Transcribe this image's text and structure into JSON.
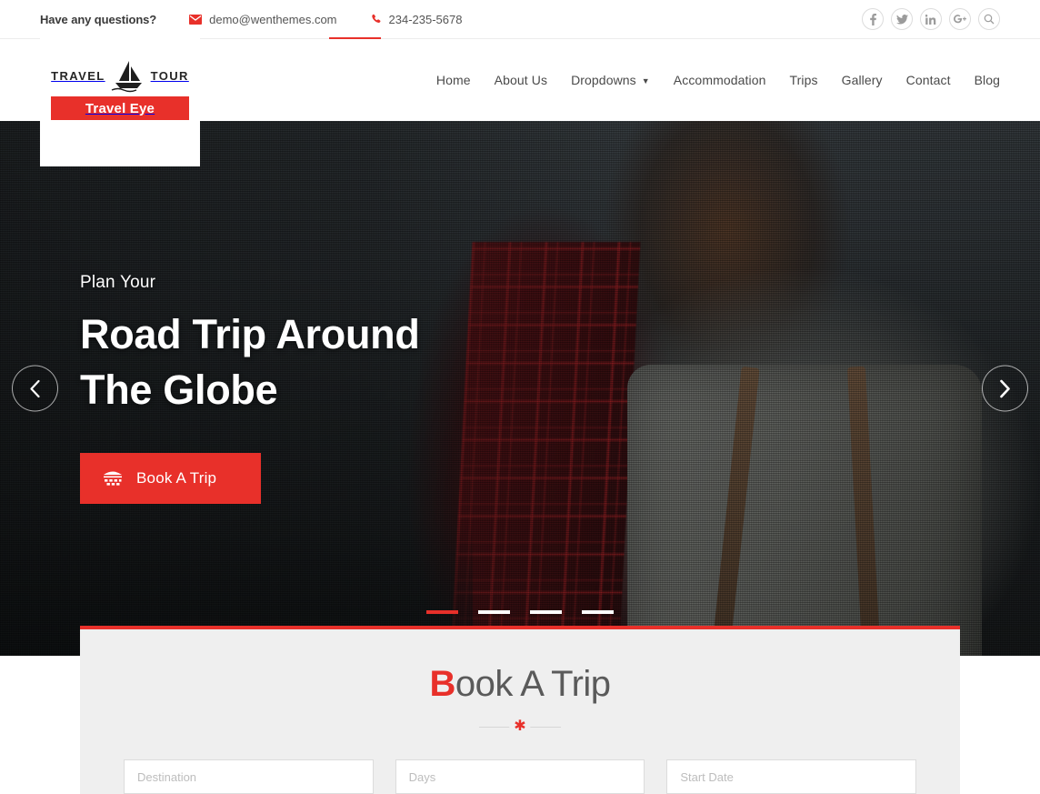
{
  "topbar": {
    "question": "Have any questions?",
    "email": "demo@wenthemes.com",
    "phone": "234-235-5678",
    "social": [
      {
        "name": "facebook",
        "label": "f"
      },
      {
        "name": "twitter",
        "label": "t"
      },
      {
        "name": "linkedin",
        "label": "in"
      },
      {
        "name": "googleplus",
        "label": "G+"
      },
      {
        "name": "search",
        "label": "Q"
      }
    ]
  },
  "logo": {
    "left_word": "TRAVEL",
    "right_word": "TOUR",
    "brand": "Travel Eye",
    "icon": "sailboat-icon"
  },
  "nav": {
    "items": [
      {
        "label": "Home",
        "has_dropdown": false,
        "active": true
      },
      {
        "label": "About Us",
        "has_dropdown": false,
        "active": false
      },
      {
        "label": "Dropdowns",
        "has_dropdown": true,
        "active": false
      },
      {
        "label": "Accommodation",
        "has_dropdown": false,
        "active": false
      },
      {
        "label": "Trips",
        "has_dropdown": false,
        "active": false
      },
      {
        "label": "Gallery",
        "has_dropdown": false,
        "active": false
      },
      {
        "label": "Contact",
        "has_dropdown": false,
        "active": false
      },
      {
        "label": "Blog",
        "has_dropdown": false,
        "active": false
      }
    ]
  },
  "hero": {
    "subtitle": "Plan Your",
    "title_line1": "Road Trip Around",
    "title_line2": "The Globe",
    "button_label": "Book A Trip",
    "button_icon": "calendar-icon",
    "prev_icon": "chevron-left-icon",
    "next_icon": "chevron-right-icon",
    "slides_total": 4,
    "slide_active": 1
  },
  "booking": {
    "title_first_letter": "B",
    "title_rest": "ook A Trip",
    "divider_icon": "asterisk-icon",
    "fields": [
      {
        "name": "destination",
        "placeholder": "Destination",
        "value": ""
      },
      {
        "name": "days",
        "placeholder": "Days",
        "value": ""
      },
      {
        "name": "start-date",
        "placeholder": "Start Date",
        "value": ""
      }
    ]
  },
  "colors": {
    "accent": "#e8302a",
    "text_dark": "#3a3a3a",
    "panel_bg": "#efefef"
  }
}
